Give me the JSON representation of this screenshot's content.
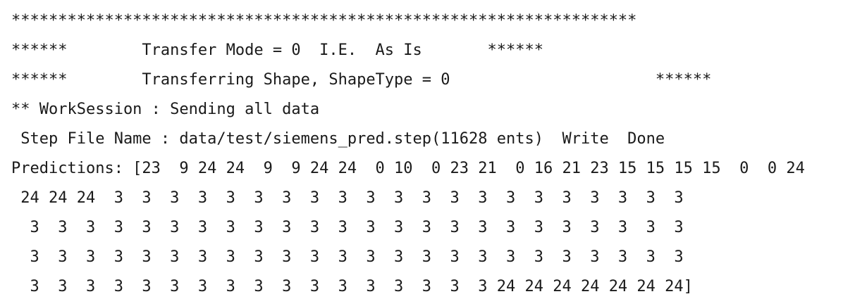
{
  "console": {
    "lines": [
      "*******************************************************************",
      "******        Transfer Mode = 0  I.E.  As Is       ******",
      "******        Transferring Shape, ShapeType = 0                      ******",
      "** WorkSession : Sending all data",
      " Step File Name : data/test/siemens_pred.step(11628 ents)  Write  Done",
      "Predictions: [23  9 24 24  9  9 24 24  0 10  0 23 21  0 16 21 23 15 15 15 15  0  0 24",
      " 24 24 24  3  3  3  3  3  3  3  3  3  3  3  3  3  3  3  3  3  3  3  3  3",
      "  3  3  3  3  3  3  3  3  3  3  3  3  3  3  3  3  3  3  3  3  3  3  3  3",
      "  3  3  3  3  3  3  3  3  3  3  3  3  3  3  3  3  3  3  3  3  3  3  3  3",
      "  3  3  3  3  3  3  3  3  3  3  3  3  3  3  3  3  3 24 24 24 24 24 24 24]"
    ]
  }
}
